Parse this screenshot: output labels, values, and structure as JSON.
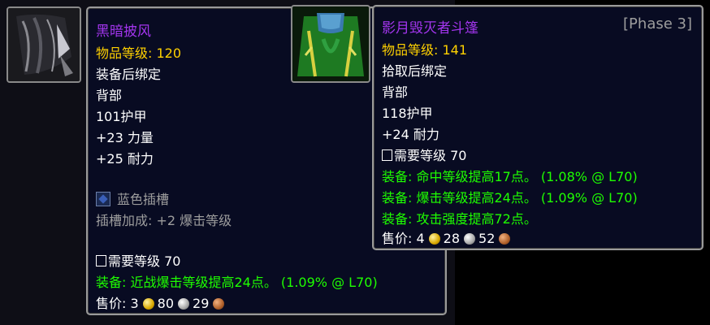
{
  "left_tooltip": {
    "name": "黑暗披风",
    "item_level_label": "物品等级:",
    "item_level_value": "120",
    "bind": "装备后绑定",
    "slot": "背部",
    "armor": "101护甲",
    "stat1": "+23 力量",
    "stat2": "+25 耐力",
    "socket": "蓝色插槽",
    "socket_bonus": "插槽加成: +2 爆击等级",
    "requires": "需要等级 70",
    "equip1": "装备: 近战爆击等级提高24点。 (1.09% @ L70)",
    "sell_label": "售价: 3",
    "silver": "80",
    "copper": "29"
  },
  "right_tooltip": {
    "name": "影月毁灭者斗篷",
    "phase": "[Phase 3]",
    "item_level_label": "物品等级:",
    "item_level_value": "141",
    "bind": "拾取后绑定",
    "slot": "背部",
    "armor": "118护甲",
    "stat1": "+24 耐力",
    "requires": "需要等级 70",
    "equip1": "装备: 命中等级提高17点。 (1.08% @ L70)",
    "equip2": "装备: 爆击等级提高24点。 (1.09% @ L70)",
    "equip3": "装备:  攻击强度提高72点。",
    "sell_label": "售价: 4",
    "silver": "28",
    "copper": "52"
  },
  "icons": {
    "left_item": "dark-cloak-icon",
    "right_item": "green-cloak-icon"
  },
  "colors": {
    "epic": "#a335ee",
    "item_level": "#ffd100",
    "equip_green": "#1eff00",
    "grey": "#9d9d9d"
  }
}
